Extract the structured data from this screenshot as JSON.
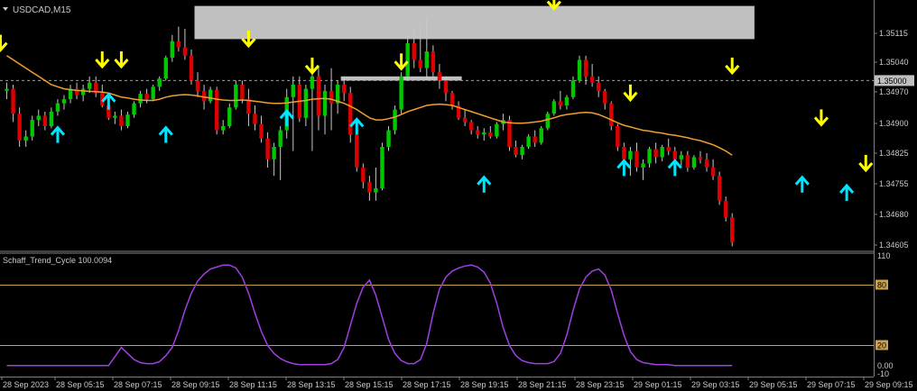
{
  "symbol_title": "USDCAD,M15",
  "indicator_title": "Schaff_Trend_Cycle 100.0094",
  "price_labels": [
    "1.35115",
    "1.35040",
    "1.34970",
    "1.34900",
    "1.34825",
    "1.34755",
    "1.34680",
    "1.34605"
  ],
  "current_price": "1.35000",
  "indicator_labels": [
    "110",
    "80",
    "20",
    "0.00",
    "-10"
  ],
  "time_labels": [
    "28 Sep 2023",
    "28 Sep 05:15",
    "28 Sep 07:15",
    "28 Sep 09:15",
    "28 Sep 11:15",
    "28 Sep 13:15",
    "28 Sep 15:15",
    "28 Sep 17:15",
    "28 Sep 19:15",
    "28 Sep 21:15",
    "28 Sep 23:15",
    "29 Sep 01:15",
    "29 Sep 03:15",
    "29 Sep 05:15",
    "29 Sep 07:15",
    "29 Sep 09:15"
  ],
  "colors": {
    "background": "#000000",
    "bull": "#00c800",
    "bear": "#dc0000",
    "ma": "#f0a030",
    "indicator": "#a040e0",
    "level": "#c8a050",
    "up_arrow": "#00e5ff",
    "down_arrow": "#ffff00",
    "zone": "#c0c0c0",
    "axis_text": "#c8c8c8",
    "price_tag": "#c0c0c0"
  },
  "chart_data": [
    {
      "type": "candlestick",
      "title": "USDCAD,M15",
      "ylim": [
        1.3459,
        1.3519
      ],
      "current_price": 1.35,
      "candles": [
        [
          1.34975,
          1.34995,
          1.34955,
          1.3498
        ],
        [
          1.3498,
          1.3499,
          1.349,
          1.3492
        ],
        [
          1.3492,
          1.34935,
          1.3484,
          1.34855
        ],
        [
          1.34855,
          1.3488,
          1.3484,
          1.34865
        ],
        [
          1.34865,
          1.34915,
          1.34855,
          1.34905
        ],
        [
          1.34905,
          1.3493,
          1.3489,
          1.34915
        ],
        [
          1.34915,
          1.34925,
          1.3488,
          1.3489
        ],
        [
          1.3489,
          1.34935,
          1.34885,
          1.34925
        ],
        [
          1.34925,
          1.34955,
          1.34915,
          1.34945
        ],
        [
          1.34945,
          1.34965,
          1.3493,
          1.34955
        ],
        [
          1.34955,
          1.3499,
          1.34945,
          1.3498
        ],
        [
          1.3498,
          1.34995,
          1.34955,
          1.34965
        ],
        [
          1.34965,
          1.3499,
          1.3495,
          1.3498
        ],
        [
          1.3498,
          1.3501,
          1.3497,
          1.34995
        ],
        [
          1.34995,
          1.3501,
          1.3496,
          1.3497
        ],
        [
          1.3497,
          1.3499,
          1.34935,
          1.3494
        ],
        [
          1.3494,
          1.3495,
          1.34905,
          1.3491
        ],
        [
          1.3491,
          1.34925,
          1.34895,
          1.34915
        ],
        [
          1.34915,
          1.3493,
          1.3488,
          1.3489
        ],
        [
          1.3489,
          1.34925,
          1.34885,
          1.34918
        ],
        [
          1.34918,
          1.3495,
          1.3491,
          1.34945
        ],
        [
          1.34945,
          1.34975,
          1.34935,
          1.34968
        ],
        [
          1.34968,
          1.3498,
          1.34945,
          1.34955
        ],
        [
          1.34955,
          1.3499,
          1.3495,
          1.34985
        ],
        [
          1.34985,
          1.3501,
          1.34975,
          1.35005
        ],
        [
          1.35005,
          1.3506,
          1.35,
          1.35055
        ],
        [
          1.35055,
          1.3511,
          1.35045,
          1.35095
        ],
        [
          1.35095,
          1.3513,
          1.3507,
          1.3508
        ],
        [
          1.3508,
          1.35125,
          1.3505,
          1.3506
        ],
        [
          1.3506,
          1.35075,
          1.3499,
          1.35
        ],
        [
          1.35,
          1.3502,
          1.3496,
          1.34975
        ],
        [
          1.34975,
          1.3499,
          1.3493,
          1.3495
        ],
        [
          1.3495,
          1.34985,
          1.34945,
          1.34978
        ],
        [
          1.34978,
          1.34985,
          1.3487,
          1.3488
        ],
        [
          1.3488,
          1.34905,
          1.3487,
          1.3489
        ],
        [
          1.3489,
          1.34945,
          1.34885,
          1.34935
        ],
        [
          1.34935,
          1.35,
          1.3493,
          1.3499
        ],
        [
          1.3499,
          1.35,
          1.34945,
          1.34955
        ],
        [
          1.34955,
          1.3498,
          1.3489,
          1.3492
        ],
        [
          1.3492,
          1.3494,
          1.3488,
          1.34895
        ],
        [
          1.34895,
          1.34915,
          1.3485,
          1.3486
        ],
        [
          1.3486,
          1.34875,
          1.3479,
          1.3481
        ],
        [
          1.3481,
          1.3485,
          1.3477,
          1.3484
        ],
        [
          1.3484,
          1.3489,
          1.3476,
          1.3488
        ],
        [
          1.3488,
          1.3498,
          1.3486,
          1.3496
        ],
        [
          1.3496,
          1.3501,
          1.3483,
          1.3499
        ],
        [
          1.3499,
          1.3501,
          1.349,
          1.3491
        ],
        [
          1.3491,
          1.3499,
          1.3489,
          1.3498
        ],
        [
          1.3498,
          1.3503,
          1.3483,
          1.3501
        ],
        [
          1.3501,
          1.35035,
          1.3488,
          1.34915
        ],
        [
          1.34915,
          1.3499,
          1.3487,
          1.34975
        ],
        [
          1.34975,
          1.3503,
          1.3488,
          1.34945
        ],
        [
          1.34945,
          1.35,
          1.3492,
          1.3499
        ],
        [
          1.3499,
          1.3501,
          1.3495,
          1.3497
        ],
        [
          1.3497,
          1.34985,
          1.3485,
          1.3487
        ],
        [
          1.3487,
          1.3488,
          1.3478,
          1.3479
        ],
        [
          1.3479,
          1.348,
          1.3474,
          1.34755
        ],
        [
          1.34755,
          1.3477,
          1.3471,
          1.3473
        ],
        [
          1.3473,
          1.3479,
          1.3471,
          1.3474
        ],
        [
          1.3474,
          1.3485,
          1.34735,
          1.3484
        ],
        [
          1.3484,
          1.3489,
          1.3483,
          1.3488
        ],
        [
          1.3488,
          1.3494,
          1.3487,
          1.3493
        ],
        [
          1.3493,
          1.3502,
          1.3492,
          1.3501
        ],
        [
          1.3501,
          1.3511,
          1.35,
          1.3509
        ],
        [
          1.3509,
          1.3512,
          1.3503,
          1.3505
        ],
        [
          1.3505,
          1.3514,
          1.3502,
          1.3503
        ],
        [
          1.3503,
          1.3515,
          1.35,
          1.3507
        ],
        [
          1.3507,
          1.35085,
          1.3501,
          1.3502
        ],
        [
          1.3502,
          1.3504,
          1.3498,
          1.35
        ],
        [
          1.35,
          1.3501,
          1.3495,
          1.3497
        ],
        [
          1.3497,
          1.34975,
          1.3493,
          1.3494
        ],
        [
          1.3494,
          1.3495,
          1.34905,
          1.3491
        ],
        [
          1.3491,
          1.3493,
          1.3489,
          1.349
        ],
        [
          1.349,
          1.34905,
          1.3487,
          1.3488
        ],
        [
          1.3488,
          1.3489,
          1.3486,
          1.3487
        ],
        [
          1.3487,
          1.34885,
          1.34855,
          1.34875
        ],
        [
          1.34875,
          1.3489,
          1.3486,
          1.34865
        ],
        [
          1.34865,
          1.349,
          1.3486,
          1.34895
        ],
        [
          1.34895,
          1.3492,
          1.3488,
          1.34905
        ],
        [
          1.34905,
          1.34915,
          1.3483,
          1.3484
        ],
        [
          1.3484,
          1.34855,
          1.34815,
          1.3482
        ],
        [
          1.3482,
          1.34845,
          1.3481,
          1.3484
        ],
        [
          1.3484,
          1.3487,
          1.34835,
          1.34865
        ],
        [
          1.34865,
          1.3488,
          1.3484,
          1.3485
        ],
        [
          1.3485,
          1.3489,
          1.34845,
          1.34885
        ],
        [
          1.34885,
          1.34925,
          1.3488,
          1.3492
        ],
        [
          1.3492,
          1.34955,
          1.34915,
          1.3495
        ],
        [
          1.3495,
          1.34975,
          1.3493,
          1.3494
        ],
        [
          1.3494,
          1.34965,
          1.3493,
          1.3496
        ],
        [
          1.3496,
          1.3501,
          1.34955,
          1.35
        ],
        [
          1.35,
          1.3506,
          1.34995,
          1.3505
        ],
        [
          1.3505,
          1.3506,
          1.3499,
          1.3501
        ],
        [
          1.3501,
          1.3504,
          1.34985,
          1.34995
        ],
        [
          1.34995,
          1.3501,
          1.3496,
          1.34975
        ],
        [
          1.34975,
          1.3498,
          1.3493,
          1.34945
        ],
        [
          1.34945,
          1.3495,
          1.3488,
          1.3489
        ],
        [
          1.3489,
          1.34895,
          1.3483,
          1.3484
        ],
        [
          1.3484,
          1.3485,
          1.348,
          1.3481
        ],
        [
          1.3481,
          1.3484,
          1.3477,
          1.3483
        ],
        [
          1.3483,
          1.3485,
          1.3478,
          1.3479
        ],
        [
          1.3479,
          1.3481,
          1.3476,
          1.348
        ],
        [
          1.348,
          1.3484,
          1.3479,
          1.34835
        ],
        [
          1.34835,
          1.3485,
          1.348,
          1.34815
        ],
        [
          1.34815,
          1.34845,
          1.34805,
          1.3484
        ],
        [
          1.3484,
          1.3486,
          1.3482,
          1.3483
        ],
        [
          1.3483,
          1.3484,
          1.3479,
          1.3481
        ],
        [
          1.3481,
          1.3483,
          1.34795,
          1.3482
        ],
        [
          1.3482,
          1.3483,
          1.3478,
          1.3479
        ],
        [
          1.3479,
          1.3482,
          1.34785,
          1.34815
        ],
        [
          1.34815,
          1.3483,
          1.348,
          1.3481
        ],
        [
          1.3481,
          1.34825,
          1.3478,
          1.3479
        ],
        [
          1.3479,
          1.3481,
          1.3476,
          1.3477
        ],
        [
          1.3477,
          1.3478,
          1.347,
          1.3471
        ],
        [
          1.3471,
          1.3472,
          1.3466,
          1.3467
        ],
        [
          1.3467,
          1.3468,
          1.346,
          1.3461
        ]
      ],
      "moving_average": [
        1.3506,
        1.3505,
        1.3504,
        1.3503,
        1.3502,
        1.3501,
        1.35,
        1.3499,
        1.34985,
        1.3498,
        1.34978,
        1.34976,
        1.34975,
        1.34974,
        1.34973,
        1.34972,
        1.3497,
        1.34965,
        1.3496,
        1.34958,
        1.34955,
        1.34953,
        1.34952,
        1.34952,
        1.34955,
        1.3496,
        1.34963,
        1.34965,
        1.34966,
        1.34965,
        1.34963,
        1.3496,
        1.34958,
        1.34955,
        1.34953,
        1.34952,
        1.34952,
        1.34953,
        1.34952,
        1.3495,
        1.34948,
        1.34946,
        1.34945,
        1.34945,
        1.34946,
        1.34948,
        1.3495,
        1.34952,
        1.34955,
        1.34956,
        1.34957,
        1.34955,
        1.3495,
        1.34945,
        1.34938,
        1.3493,
        1.3492,
        1.3491,
        1.34905,
        1.34905,
        1.34908,
        1.34912,
        1.34918,
        1.34925,
        1.3493,
        1.34935,
        1.3494,
        1.34942,
        1.34943,
        1.34942,
        1.3494,
        1.34935,
        1.3493,
        1.34925,
        1.3492,
        1.34915,
        1.3491,
        1.34905,
        1.349,
        1.34898,
        1.34897,
        1.34897,
        1.34898,
        1.349,
        1.34902,
        1.34906,
        1.3491,
        1.34915,
        1.34918,
        1.3492,
        1.34922,
        1.34923,
        1.34922,
        1.34918,
        1.34912,
        1.34905,
        1.34898,
        1.34892,
        1.34888,
        1.34884,
        1.3488,
        1.34878,
        1.34875,
        1.34873,
        1.3487,
        1.34868,
        1.34865,
        1.34862,
        1.34858,
        1.34855,
        1.3485,
        1.34845,
        1.34838,
        1.3483,
        1.3482
      ],
      "zones": [
        {
          "start": 30,
          "end": 117,
          "top": 1.3518,
          "bottom": 1.351
        },
        {
          "start": 53,
          "end": 71,
          "top": 1.3501,
          "bottom": 1.35
        }
      ],
      "up_arrows": [
        {
          "i": 8,
          "price": 1.3488
        },
        {
          "i": 16,
          "price": 1.3496
        },
        {
          "i": 25,
          "price": 1.3488
        },
        {
          "i": 44,
          "price": 1.3492
        },
        {
          "i": 55,
          "price": 1.349
        },
        {
          "i": 75,
          "price": 1.3476
        },
        {
          "i": 97,
          "price": 1.348
        },
        {
          "i": 105,
          "price": 1.348
        },
        {
          "i": 125,
          "price": 1.3476
        },
        {
          "i": 132,
          "price": 1.3474
        }
      ],
      "down_arrows": [
        {
          "i": -1,
          "price": 1.3508
        },
        {
          "i": 15,
          "price": 1.3504
        },
        {
          "i": 18,
          "price": 1.3504
        },
        {
          "i": 38,
          "price": 1.3509
        },
        {
          "i": 48,
          "price": 1.35025
        },
        {
          "i": 62,
          "price": 1.35035
        },
        {
          "i": 86,
          "price": 1.3518
        },
        {
          "i": 114,
          "price": 1.35025
        },
        {
          "i": 98,
          "price": 1.3496
        },
        {
          "i": 128,
          "price": 1.349
        },
        {
          "i": 135,
          "price": 1.3479
        }
      ]
    },
    {
      "type": "line",
      "title": "Schaff_Trend_Cycle 100.0094",
      "ylim": [
        -10,
        110
      ],
      "levels": [
        80,
        20
      ],
      "values": [
        0,
        0,
        0,
        0,
        0,
        0,
        0,
        0,
        0,
        0,
        0,
        0,
        0,
        0,
        0,
        0,
        0,
        9,
        18,
        12,
        6,
        3,
        2,
        2,
        4,
        10,
        18,
        35,
        55,
        72,
        84,
        91,
        96,
        98,
        100,
        100,
        97,
        88,
        72,
        52,
        34,
        20,
        12,
        7,
        4,
        2,
        1,
        1,
        1,
        1,
        1,
        2,
        6,
        18,
        40,
        62,
        78,
        85,
        70,
        48,
        26,
        12,
        5,
        2,
        2,
        6,
        22,
        52,
        76,
        88,
        94,
        97,
        99,
        100,
        98,
        93,
        82,
        62,
        38,
        20,
        10,
        5,
        3,
        2,
        2,
        2,
        4,
        12,
        30,
        55,
        76,
        88,
        94,
        96,
        90,
        75,
        52,
        30,
        14,
        6,
        3,
        2,
        1,
        1,
        1,
        0,
        0,
        0,
        0,
        0,
        0,
        0,
        0,
        0,
        0
      ]
    }
  ]
}
